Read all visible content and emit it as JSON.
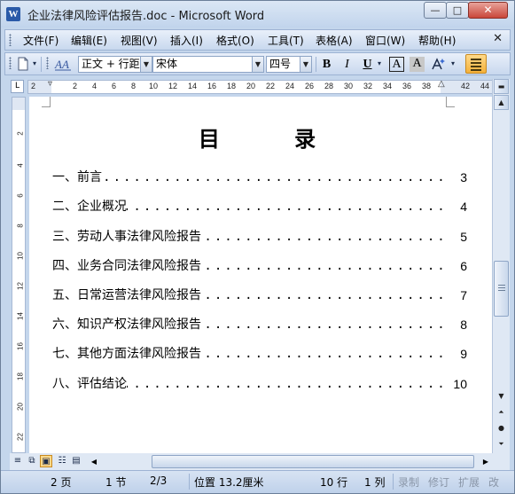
{
  "window": {
    "title": "企业法律风险评估报告.doc - Microsoft Word",
    "app_icon": "W",
    "minimize_glyph": "—",
    "maximize_glyph": "□",
    "close_glyph": "✕"
  },
  "menu": {
    "items": [
      "文件(F)",
      "编辑(E)",
      "视图(V)",
      "插入(I)",
      "格式(O)",
      "工具(T)",
      "表格(A)",
      "窗口(W)",
      "帮助(H)"
    ],
    "close_glyph": "✕"
  },
  "toolbar": {
    "style_combo": "正文 + 行距",
    "font_combo": "宋体",
    "size_combo": "四号",
    "bold": "B",
    "italic": "I",
    "underline": "U",
    "border_char": "A",
    "shading_char": "A"
  },
  "ruler": {
    "numbers": [
      "2",
      "2",
      "4",
      "6",
      "8",
      "10",
      "12",
      "14",
      "16",
      "18",
      "20",
      "22",
      "24",
      "26",
      "28",
      "30",
      "32",
      "34",
      "36",
      "38",
      "42",
      "44"
    ]
  },
  "vruler": {
    "numbers": [
      "2",
      "4",
      "6",
      "8",
      "10",
      "12",
      "14",
      "16",
      "18",
      "20",
      "22"
    ]
  },
  "document": {
    "title": "目 录",
    "dots": "............................................................................................................",
    "toc": [
      {
        "label": "一、前言",
        "page": "3"
      },
      {
        "label": "二、企业概况",
        "page": "4"
      },
      {
        "label": "三、劳动人事法律风险报告",
        "page": "5"
      },
      {
        "label": "四、业务合同法律风险报告",
        "page": "6"
      },
      {
        "label": "五、日常运营法律风险报告",
        "page": "7"
      },
      {
        "label": "六、知识产权法律风险报告",
        "page": "8"
      },
      {
        "label": "七、其他方面法律风险报告",
        "page": "9"
      },
      {
        "label": "八、评估结论",
        "page": "10"
      }
    ]
  },
  "statusbar": {
    "page": "2 页",
    "section": "1 节",
    "page_of": "2/3",
    "position": "位置 13.2厘米",
    "line": "10 行",
    "column": "1 列",
    "record": "录制",
    "revise": "修订",
    "extend": "扩展",
    "overtype": "改"
  },
  "colors": {
    "frame": "#c4d6ec",
    "accent_highlight": "#f4b13a"
  }
}
